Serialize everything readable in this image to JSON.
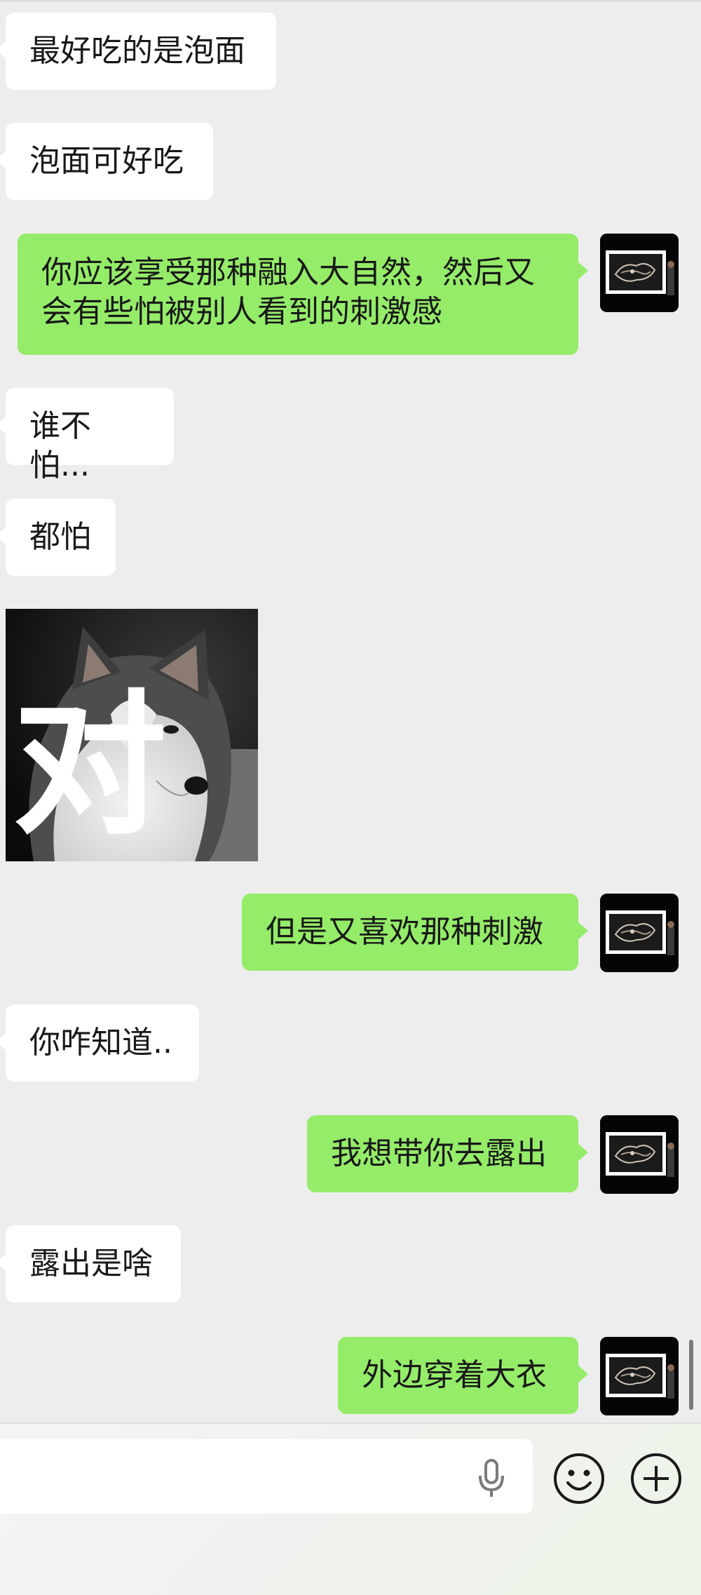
{
  "chat": {
    "messages": [
      {
        "side": "in",
        "text": "最好吃的是泡面"
      },
      {
        "side": "in",
        "text": "泡面可好吃"
      },
      {
        "side": "out",
        "text": "你应该享受那种融入大自然，然后又会有些怕被别人看到的刺激感"
      },
      {
        "side": "in",
        "text": "谁不怕..."
      },
      {
        "side": "in",
        "text": "都怕"
      },
      {
        "side": "in",
        "type": "image",
        "image_text": "对",
        "description_icon": "husky-dog-meme-image"
      },
      {
        "side": "out",
        "text": "但是又喜欢那种刺激"
      },
      {
        "side": "in",
        "text": "你咋知道.."
      },
      {
        "side": "out",
        "text": "我想带你去露出"
      },
      {
        "side": "in",
        "text": "露出是啥"
      },
      {
        "side": "out",
        "text": "外边穿着大衣"
      }
    ]
  },
  "input_bar": {
    "value": "",
    "icons": {
      "voice": "microphone-icon",
      "emoji": "smiley-face-icon",
      "more": "plus-circle-icon"
    }
  },
  "colors": {
    "background": "#ededed",
    "incoming_bubble": "#ffffff",
    "outgoing_bubble": "#95ec69",
    "text": "#191919"
  }
}
